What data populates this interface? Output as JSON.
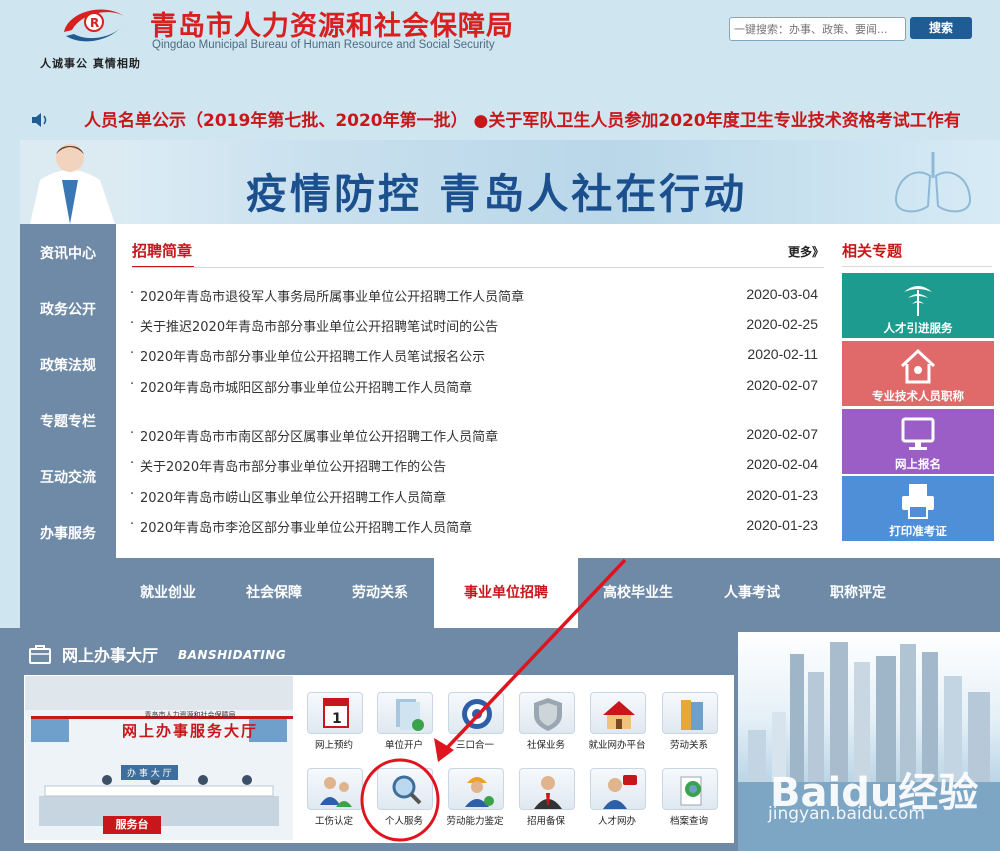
{
  "header": {
    "title": "青岛市人力资源和社会保障局",
    "subtitle": "Qingdao Municipal Bureau of Human Resource and Social Security",
    "slogan": "人诚事公  真情相助",
    "search_placeholder": "一键搜索：办事、政策、要闻...",
    "search_button": "搜索"
  },
  "ticker": {
    "text": "人员名单公示（2019年第七批、2020年第一批）  ●关于军队卫生人员参加2020年度卫生专业技术资格考试工作有"
  },
  "banner": {
    "title": "疫情防控  青岛人社在行动"
  },
  "left_nav": [
    "资讯中心",
    "政务公开",
    "政策法规",
    "专题专栏",
    "互动交流",
    "办事服务"
  ],
  "news": {
    "tab_title": "招聘简章",
    "more": "更多》",
    "items": [
      {
        "title": "2020年青岛市退役军人事务局所属事业单位公开招聘工作人员简章",
        "date": "2020-03-04"
      },
      {
        "title": "关于推迟2020年青岛市部分事业单位公开招聘笔试时间的公告",
        "date": "2020-02-25"
      },
      {
        "title": "2020年青岛市部分事业单位公开招聘工作人员笔试报名公示",
        "date": "2020-02-11"
      },
      {
        "title": "2020年青岛市城阳区部分事业单位公开招聘工作人员简章",
        "date": "2020-02-07"
      },
      {
        "title": "2020年青岛市市南区部分区属事业单位公开招聘工作人员简章",
        "date": "2020-02-07"
      },
      {
        "title": "关于2020年青岛市部分事业单位公开招聘工作的公告",
        "date": "2020-02-04"
      },
      {
        "title": "2020年青岛市崂山区事业单位公开招聘工作人员简章",
        "date": "2020-01-23"
      },
      {
        "title": "2020年青岛市李沧区部分事业单位公开招聘工作人员简章",
        "date": "2020-01-23"
      }
    ]
  },
  "topics": {
    "title": "相关专题",
    "cards": [
      {
        "label": "人才引进服务",
        "color": "#1d9b8f"
      },
      {
        "label": "专业技术人员职称",
        "color": "#e06a6a"
      },
      {
        "label": "网上报名",
        "color": "#9b5ec6"
      },
      {
        "label": "打印准考证",
        "color": "#4f8fd8"
      }
    ]
  },
  "categories": [
    "就业创业",
    "社会保障",
    "劳动关系",
    "事业单位招聘",
    "高校毕业生",
    "人事考试",
    "职称评定"
  ],
  "hall": {
    "title": "网上办事大厅",
    "subtitle": "BANSHIDATING",
    "sign_small": "青岛市人力资源和社会保障局",
    "sign_big": "网上办事服务大厅",
    "counter": "服务台",
    "hall_chars": "办  事  大  厅",
    "services_row1": [
      "网上预约",
      "单位开户",
      "三口合一",
      "社保业务",
      "就业网办平台",
      "劳动关系"
    ],
    "services_row2": [
      "工伤认定",
      "个人服务",
      "劳动能力鉴定",
      "招用备保",
      "人才网办",
      "档案查询"
    ]
  },
  "watermark": {
    "brand": "Baidu经验",
    "site": "jingyan.baidu.com"
  },
  "colors": {
    "brand_red": "#c8171a",
    "nav_blue": "#6e8aa7",
    "annotation_red": "#e0141e"
  }
}
